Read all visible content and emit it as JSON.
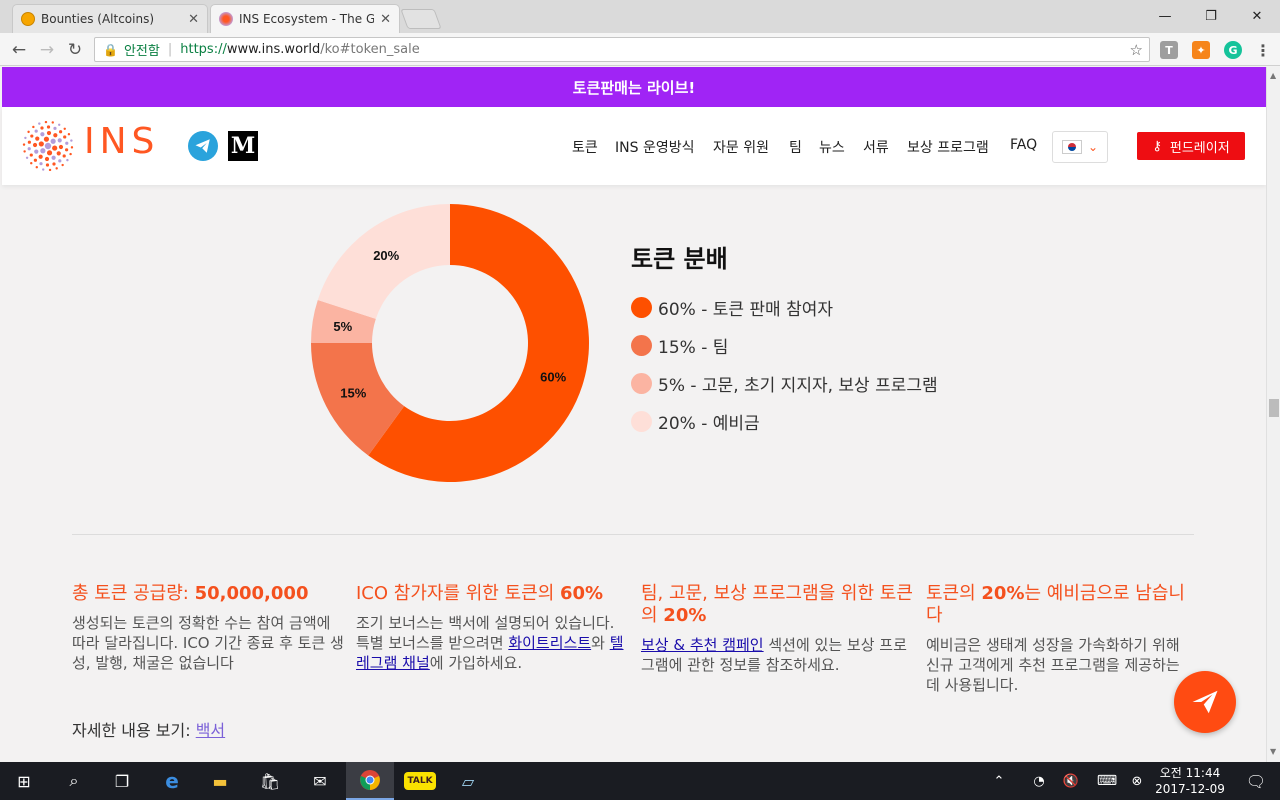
{
  "browser": {
    "tabs": [
      {
        "title": "Bounties (Altcoins)",
        "active": false
      },
      {
        "title": "INS Ecosystem - The Gr",
        "active": true
      }
    ],
    "secure_label": "안전함",
    "url_scheme": "https://",
    "url_host": "www.ins.world",
    "url_path": "/ko#token_sale",
    "window_controls": {
      "minimize": "—",
      "restore": "❐",
      "close": "✕"
    }
  },
  "banner": {
    "text": "토큰판매는 라이브!"
  },
  "header": {
    "logo_text": "INS",
    "medium_letter": "M",
    "nav": [
      "토큰",
      "INS 운영방식",
      "자문 위원",
      "팀",
      "뉴스",
      "서류",
      "보상 프로그램",
      "FAQ"
    ],
    "fundraiser_label": "펀드레이저"
  },
  "distribution": {
    "title": "토큰 분배",
    "legend": [
      {
        "label": "60% - 토큰 판매 참여자",
        "color": "#fe5000"
      },
      {
        "label": "15% - 팀",
        "color": "#f3744b"
      },
      {
        "label": "5% - 고문, 초기 지지자, 보상 프로그램",
        "color": "#fbb4a2"
      },
      {
        "label": "20% - 예비금",
        "color": "#fedfd8"
      }
    ]
  },
  "chart_data": {
    "type": "pie",
    "donut": true,
    "categories": [
      "토큰 판매 참여자",
      "팀",
      "고문, 초기 지지자, 보상 프로그램",
      "예비금"
    ],
    "values": [
      60,
      15,
      5,
      20
    ],
    "labels": [
      "60%",
      "15%",
      "5%",
      "20%"
    ],
    "colors": [
      "#fe5000",
      "#f3744b",
      "#fbb4a2",
      "#fedfd8"
    ]
  },
  "columns": [
    {
      "title_prefix": "총 토큰 공급량: ",
      "title_bold": "50,000,000",
      "body": "생성되는 토큰의 정확한 수는 참여 금액에 따라 달라집니다. ICO 기간 종료 후 토큰 생성, 발행, 채굴은 없습니다"
    },
    {
      "title_prefix": "ICO 참가자를 위한 토큰의 ",
      "title_bold": "60%",
      "body_1": "조기 보너스는 백서에 설명되어 있습니다. 특별 보너스를 받으려면 ",
      "link_1": "화이트리스트",
      "body_2": "와 ",
      "link_2": "텔레그램 채널",
      "body_3": "에 가입하세요."
    },
    {
      "title_prefix": "팀, 고문, 보상 프로그램을 위한 토큰의 ",
      "title_bold": "20%",
      "link_1": "보상 & 추천 캠페인",
      "body": " 섹션에 있는 보상 프로그램에 관한 정보를 참조하세요."
    },
    {
      "title_prefix": "토큰의 ",
      "title_bold": "20%",
      "title_suffix": "는 예비금으로 남습니다",
      "body": "예비금은 생태계 성장을 가속화하기 위해 신규 고객에게 추천 프로그램을 제공하는 데 사용됩니다."
    }
  ],
  "more": {
    "label": "자세한 내용 보기: ",
    "link": "백서"
  },
  "taskbar": {
    "time": "오전 11:44",
    "date": "2017-12-09"
  }
}
